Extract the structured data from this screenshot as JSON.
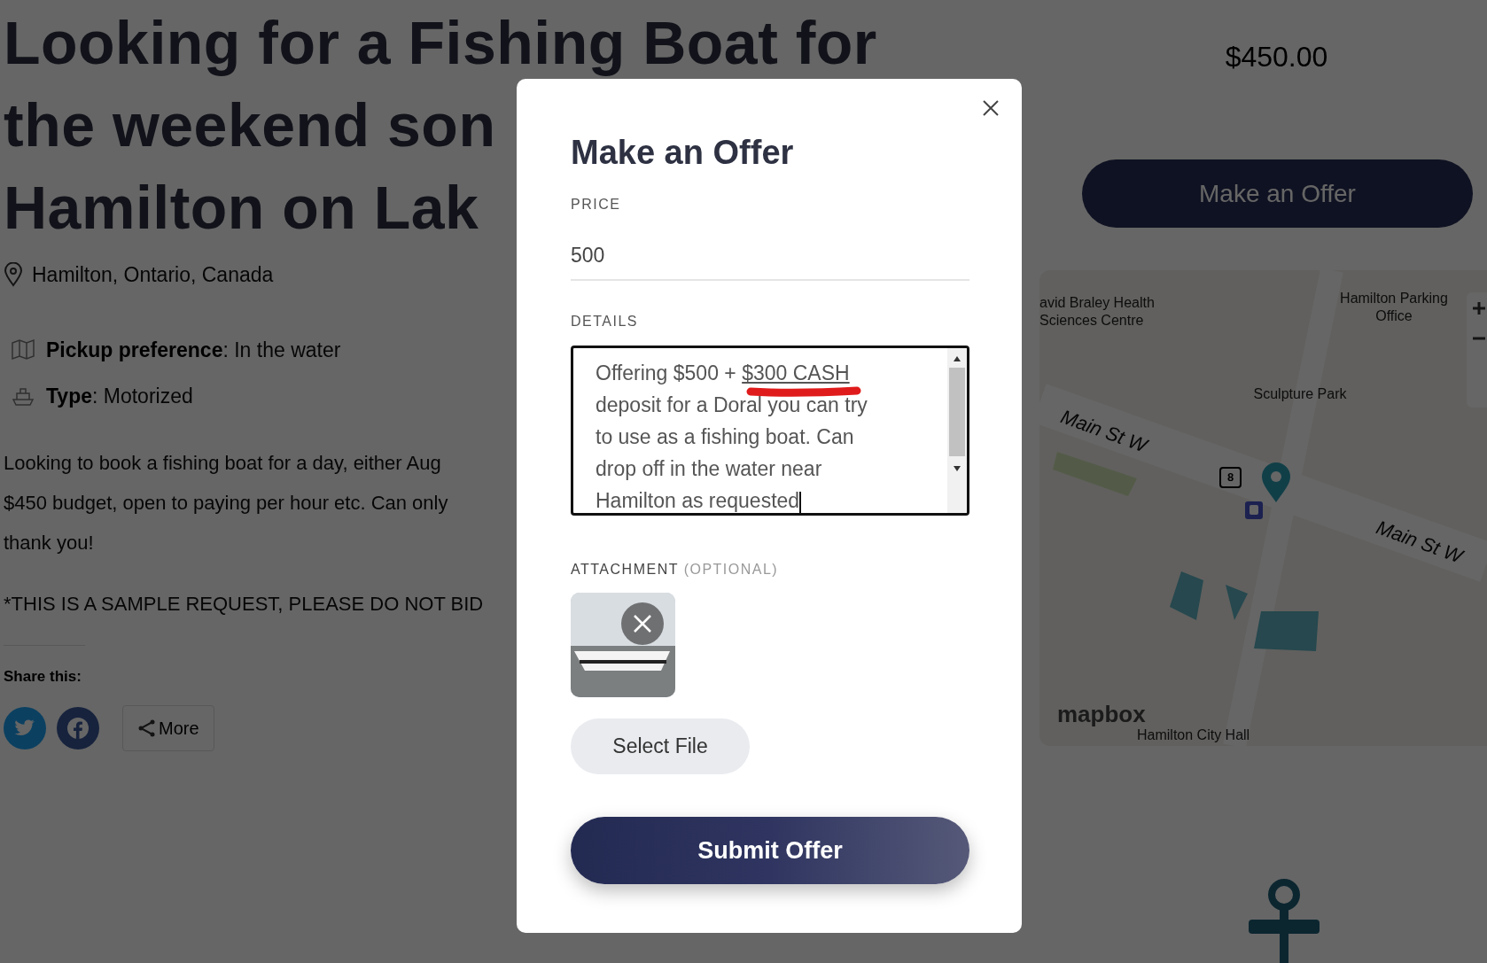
{
  "listing": {
    "title_lines": [
      "Looking for a Fishing Boat for",
      "the weekend son",
      "Hamilton on Lak"
    ],
    "location": "Hamilton, Ontario, Canada",
    "attributes": [
      {
        "kind": "pickup",
        "text": "**Pickup preference**: In the water"
      },
      {
        "kind": "type",
        "text": "**Type**: Motorized"
      }
    ],
    "description_lines": [
      "Looking to book a fishing boat for a day, either Aug",
      "$450 budget, open to paying per hour etc. Can only",
      "thank you!"
    ],
    "notice": "*THIS IS A SAMPLE REQUEST, PLEASE DO NOT BID",
    "share": {
      "heading": "Share this:",
      "buttons": [
        {
          "kind": "twitter"
        },
        {
          "kind": "facebook"
        },
        {
          "kind": "more",
          "label": "More"
        }
      ]
    }
  },
  "sidebar": {
    "price": "$450.00",
    "offer_button": "Make an Offer",
    "map": {
      "labels": [
        {
          "kind": "place",
          "text": "avid Braley Health Sciences Centre"
        },
        {
          "kind": "place",
          "text": "Hamilton Parking Office"
        },
        {
          "kind": "place",
          "text": "Sculpture Park"
        },
        {
          "kind": "road",
          "text": "Main St W"
        },
        {
          "kind": "road",
          "text": "Main St W"
        },
        {
          "kind": "shield",
          "text": "8"
        },
        {
          "kind": "credit",
          "text": "mapbox"
        },
        {
          "kind": "place",
          "text": "Hamilton City Hall"
        }
      ]
    }
  },
  "modal": {
    "title": "Make an Offer",
    "price": {
      "label": "PRICE",
      "value": "500"
    },
    "details": {
      "label": "DETAILS",
      "focused": true,
      "segments": [
        {
          "text": "Offering $500 + ",
          "marked": false
        },
        {
          "text": "$300 CASH",
          "marked": true
        },
        {
          "text": " deposit for a Doral you can try to use as a fishing boat. Can drop off in the water near Hamilton as requested",
          "marked": false
        }
      ]
    },
    "attachment": {
      "label": "ATTACHMENT",
      "hint": "(OPTIONAL)",
      "files": [
        {
          "kind": "image"
        }
      ]
    },
    "select_button": "Select File",
    "submit_button": "Submit Offer"
  }
}
